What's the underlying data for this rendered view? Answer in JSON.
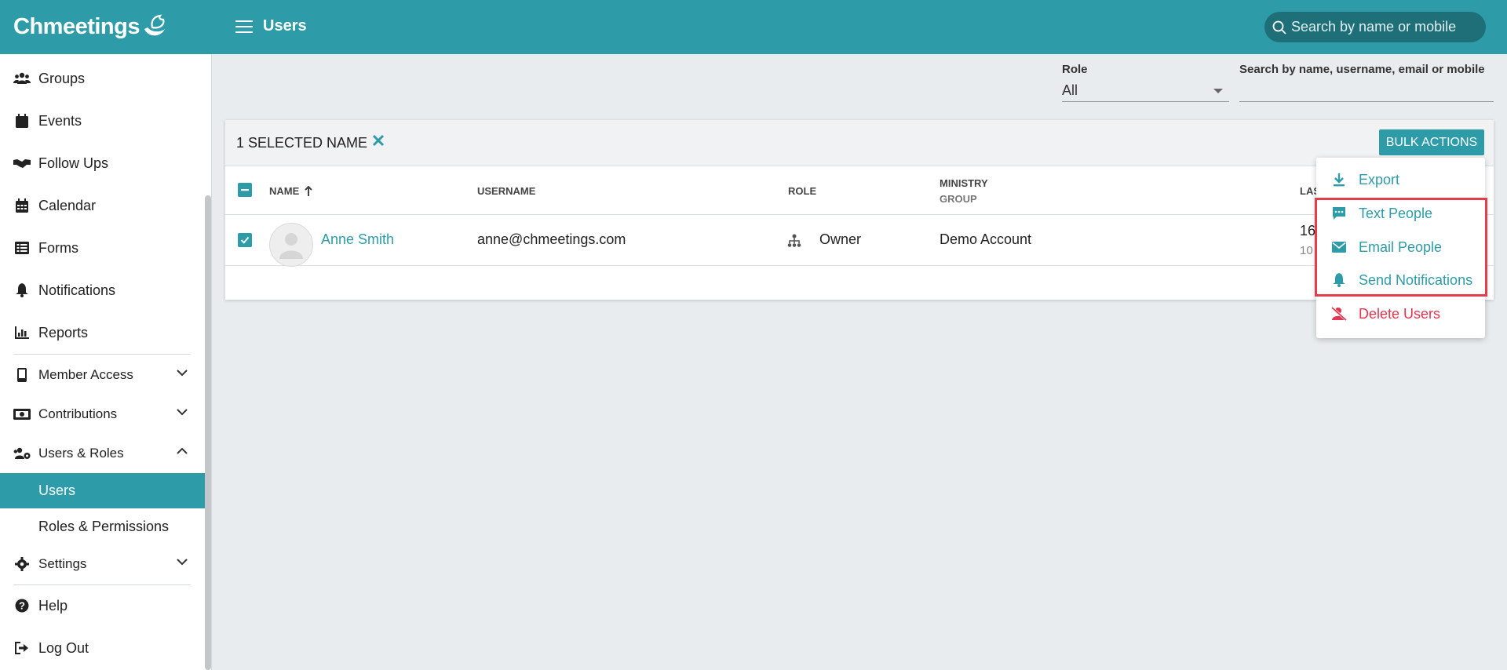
{
  "app": {
    "logo_text": "Chmeetings",
    "page_title": "Users"
  },
  "topbar": {
    "search_placeholder": "Search by name or mobile"
  },
  "sidebar": {
    "items": [
      {
        "label": "Groups",
        "icon": "users-group-icon"
      },
      {
        "label": "Events",
        "icon": "calendar-event-icon"
      },
      {
        "label": "Follow Ups",
        "icon": "handshake-icon"
      },
      {
        "label": "Calendar",
        "icon": "calendar-icon"
      },
      {
        "label": "Forms",
        "icon": "form-list-icon"
      },
      {
        "label": "Notifications",
        "icon": "bell-icon"
      },
      {
        "label": "Reports",
        "icon": "bar-chart-icon"
      },
      {
        "label": "Member Access",
        "icon": "mobile-icon",
        "expanded": false
      },
      {
        "label": "Contributions",
        "icon": "money-icon",
        "expanded": false
      },
      {
        "label": "Users & Roles",
        "icon": "users-cog-icon",
        "expanded": true
      },
      {
        "label": "Users",
        "active": true
      },
      {
        "label": "Roles & Permissions"
      },
      {
        "label": "Settings",
        "icon": "gear-icon",
        "expanded": false
      },
      {
        "label": "Help",
        "icon": "question-circle-icon"
      },
      {
        "label": "Log Out",
        "icon": "logout-icon"
      }
    ]
  },
  "filters": {
    "role_label": "Role",
    "role_value": "All",
    "search_label": "Search by name, username, email or mobile",
    "search_value": ""
  },
  "table": {
    "selection_text": "1 SELECTED NAME",
    "bulk_actions_label": "BULK ACTIONS",
    "columns": {
      "name": "NAME",
      "username": "USERNAME",
      "role": "ROLE",
      "ministry": "MINISTRY",
      "ministry_sub": "GROUP",
      "last_partial": "LAS"
    },
    "rows": [
      {
        "name": "Anne Smith",
        "username": "anne@chmeetings.com",
        "role": "Owner",
        "ministry": "Demo Account",
        "last_partial_1": "16",
        "last_partial_2": "10"
      }
    ]
  },
  "bulk_menu": {
    "items": [
      {
        "label": "Export",
        "icon": "download-icon"
      },
      {
        "label": "Text People",
        "icon": "sms-icon"
      },
      {
        "label": "Email People",
        "icon": "envelope-icon"
      },
      {
        "label": "Send Notifications",
        "icon": "bell-icon"
      },
      {
        "label": "Delete Users",
        "icon": "delete-user-icon",
        "danger": true
      }
    ]
  },
  "colors": {
    "brand": "#2d9ca8",
    "danger": "#e4344f",
    "highlight": "#e53e4a"
  }
}
